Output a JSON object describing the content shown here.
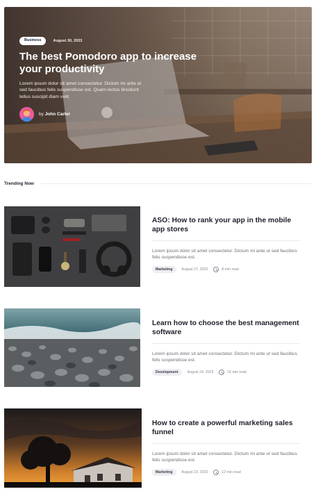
{
  "hero": {
    "category": "Business",
    "date": "August 30, 2023",
    "title": "The best Pomodoro app to increase your productivity",
    "excerpt": "Lorem ipsum dolor sit amet consectetur. Dictum mi ante ut sed faucibus felis suspendisse est. Quam lectus tincidunt tellus suscipit diam velit.",
    "author_prefix": "by",
    "author_name": "John Carter"
  },
  "trending": {
    "label": "Trending Now"
  },
  "articles": [
    {
      "title": "ASO: How to rank your app in the mobile app stores",
      "excerpt": "Lorem ipsum dolor sit amet consectetur. Dictum mi ante ut sed faucibus felis suspendisse est.",
      "category": "Marketing",
      "date": "August 27, 2023",
      "read_time": "8 min read",
      "image": "flat-lay-accessories-photo"
    },
    {
      "title": "Learn how to choose the best management software",
      "excerpt": "Lorem ipsum dolor sit amet consectetur. Dictum mi ante ut sed faucibus felis suspendisse est.",
      "category": "Development",
      "date": "August 24, 2023",
      "read_time": "16 min read",
      "image": "pebble-beach-photo"
    },
    {
      "title": "How to create a powerful marketing sales funnel",
      "excerpt": "Lorem ipsum dolor sit amet consectetur. Dictum mi ante ut sed faucibus felis suspendisse est.",
      "category": "Marketing",
      "date": "August 23, 2023",
      "read_time": "12 min read",
      "image": "sunset-house-photo"
    }
  ]
}
